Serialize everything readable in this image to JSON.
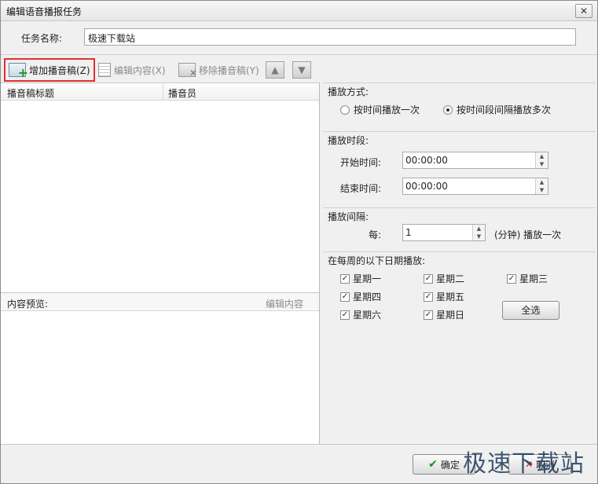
{
  "window": {
    "title": "编辑语音播报任务"
  },
  "task": {
    "label": "任务名称:",
    "value": "极速下载站"
  },
  "toolbar": {
    "add_label": "增加播音稿(Z)",
    "edit_label": "编辑内容(X)",
    "remove_label": "移除播音稿(Y)"
  },
  "list": {
    "col_title": "播音稿标题",
    "col_announcer": "播音员"
  },
  "preview": {
    "label": "内容预览:",
    "edit_link": "编辑内容"
  },
  "play_mode": {
    "header": "播放方式:",
    "option1": "按时间播放一次",
    "option2": "按时间段间隔播放多次",
    "selected": "option2"
  },
  "play_period": {
    "header": "播放时段:",
    "start_label": "开始时间:",
    "start_value": "00:00:00",
    "end_label": "结束时间:",
    "end_value": "00:00:00"
  },
  "play_interval": {
    "header": "播放间隔:",
    "every_label": "每:",
    "value": "1",
    "suffix": "(分钟) 播放一次"
  },
  "weekdays": {
    "header": "在每周的以下日期播放:",
    "days": [
      "星期一",
      "星期二",
      "星期三",
      "星期四",
      "星期五",
      "星期六",
      "星期日"
    ],
    "select_all": "全选"
  },
  "footer": {
    "ok_label": "确定",
    "cancel_label": "取消"
  },
  "watermark": "极速下载站"
}
